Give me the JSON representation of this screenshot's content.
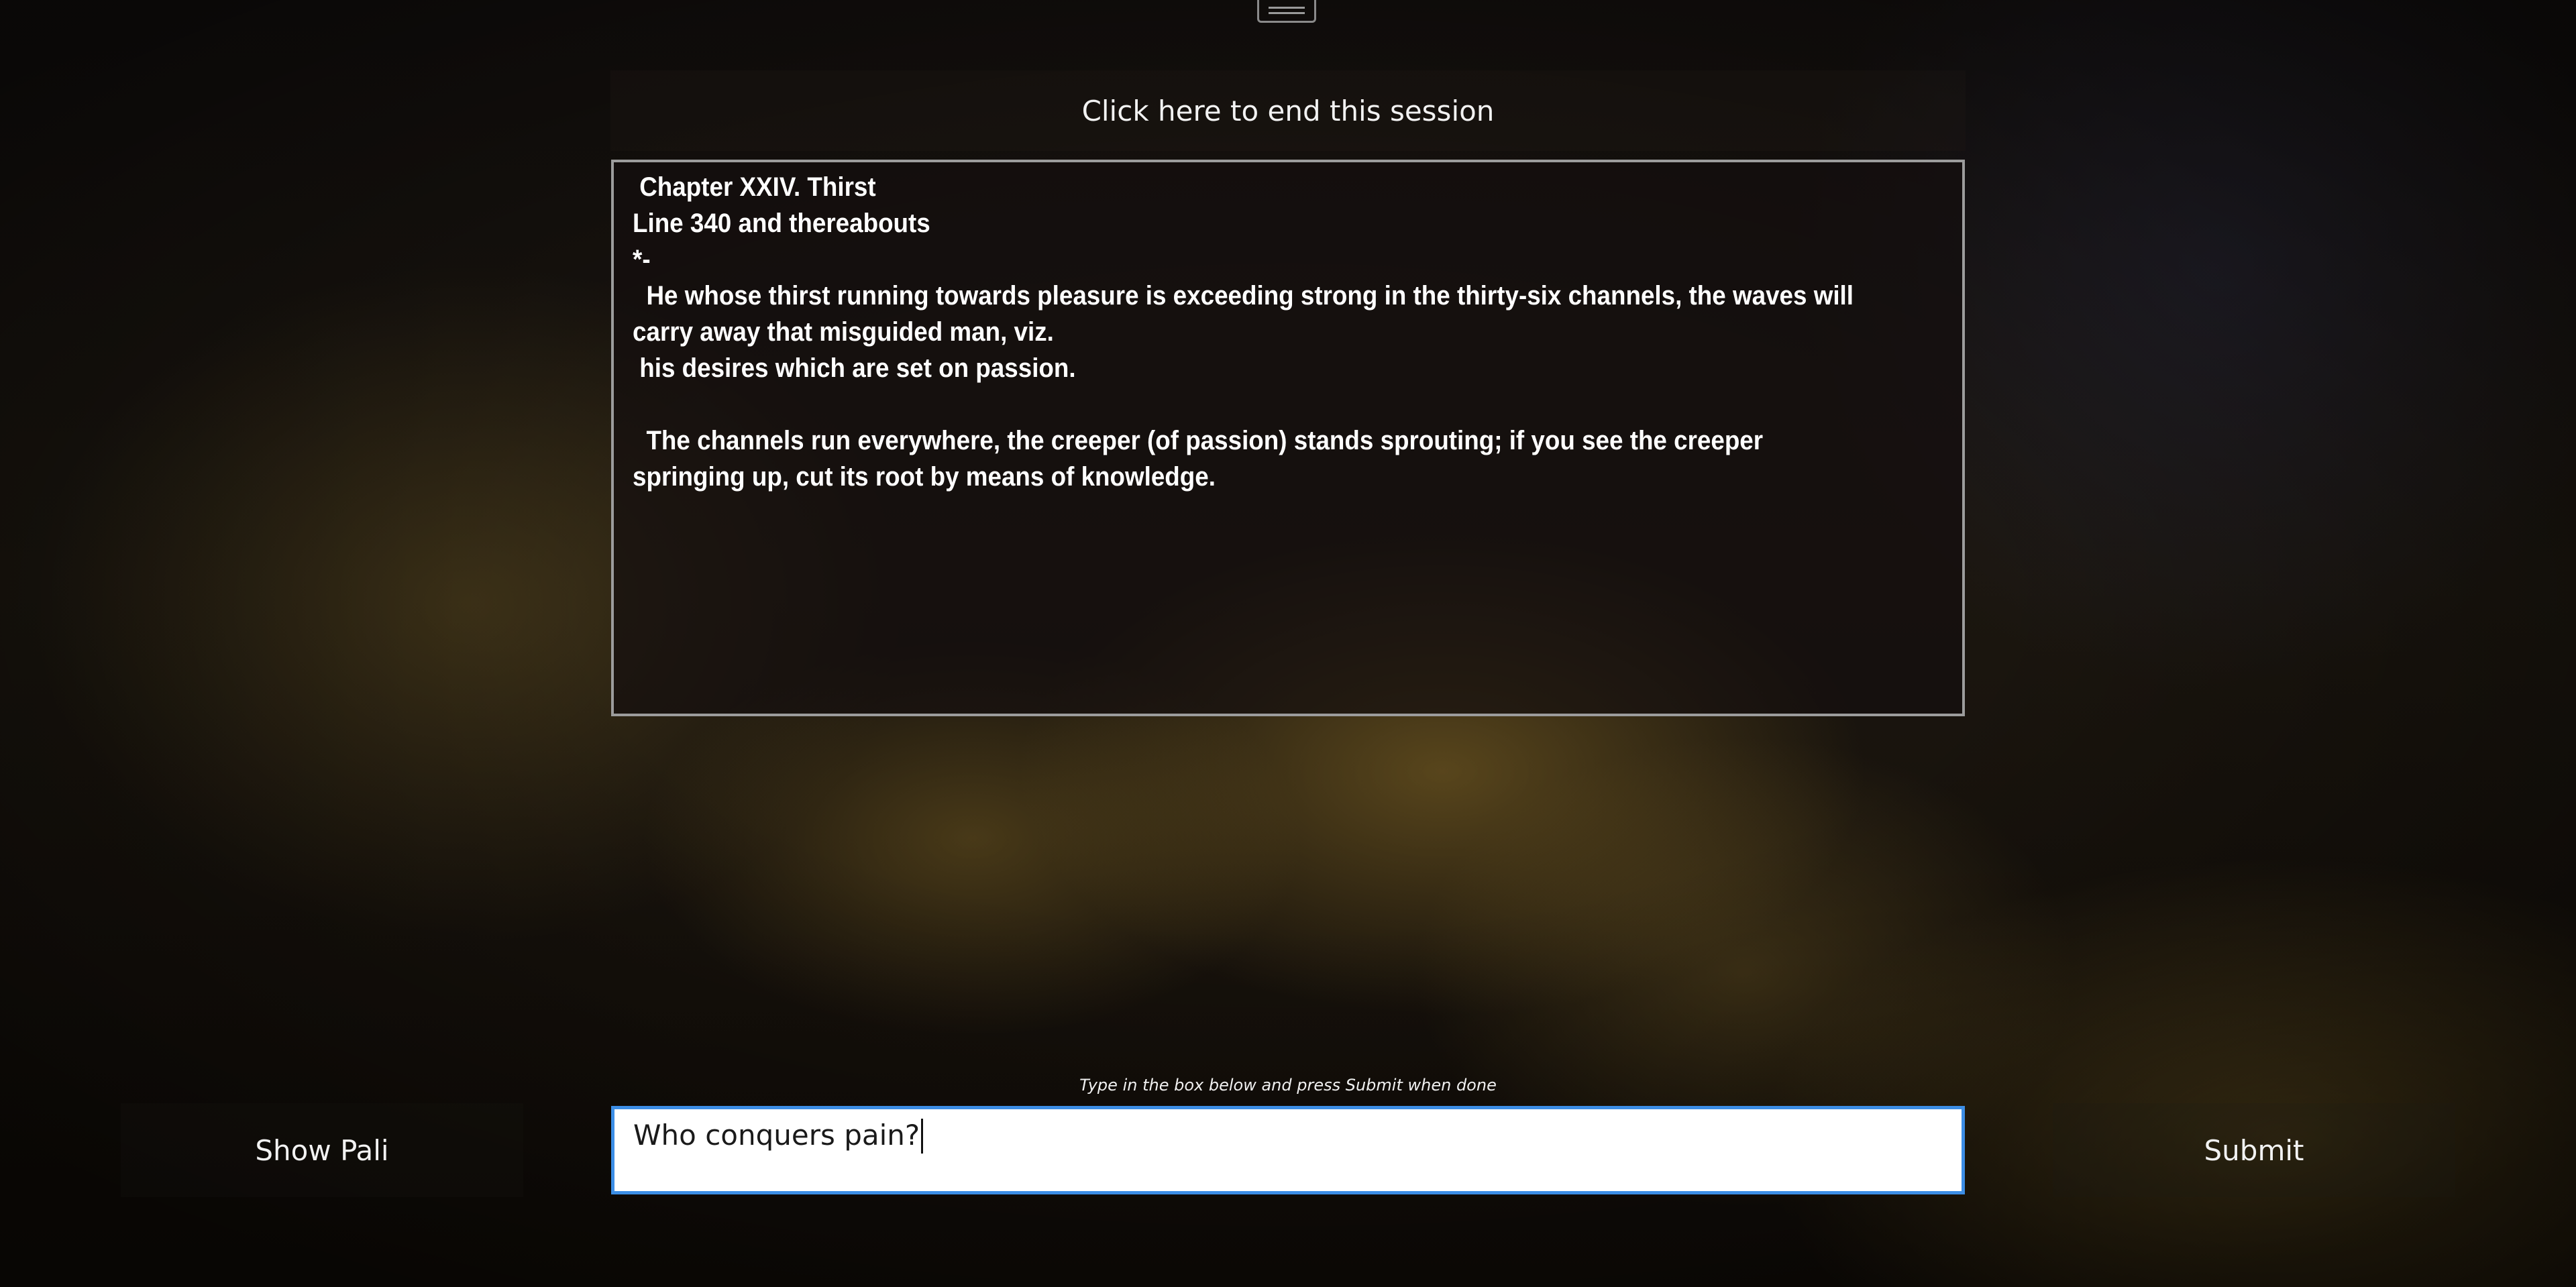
{
  "header": {
    "end_session_label": "Click here to end this session"
  },
  "passage": {
    "lines": [
      " Chapter XXIV. Thirst",
      "Line 340 and thereabouts",
      "*-",
      "  He whose thirst running towards pleasure is exceeding strong in the thirty-six channels, the waves will",
      "carry away that misguided man, viz.",
      " his desires which are set on passion.",
      "",
      "  The channels run everywhere, the creeper (of passion) stands sprouting; if you see the creeper",
      "springing up, cut its root by means of knowledge."
    ]
  },
  "answer": {
    "hint": "Type in the box below and press Submit when done",
    "value": "Who conquers pain?"
  },
  "actions": {
    "show_pali_label": "Show Pali",
    "submit_label": "Submit"
  },
  "icons": {
    "top_grip": "drag-handle-icon"
  },
  "colors": {
    "input_border": "#3c8ee6",
    "panel_border": "#9c9c9c"
  }
}
